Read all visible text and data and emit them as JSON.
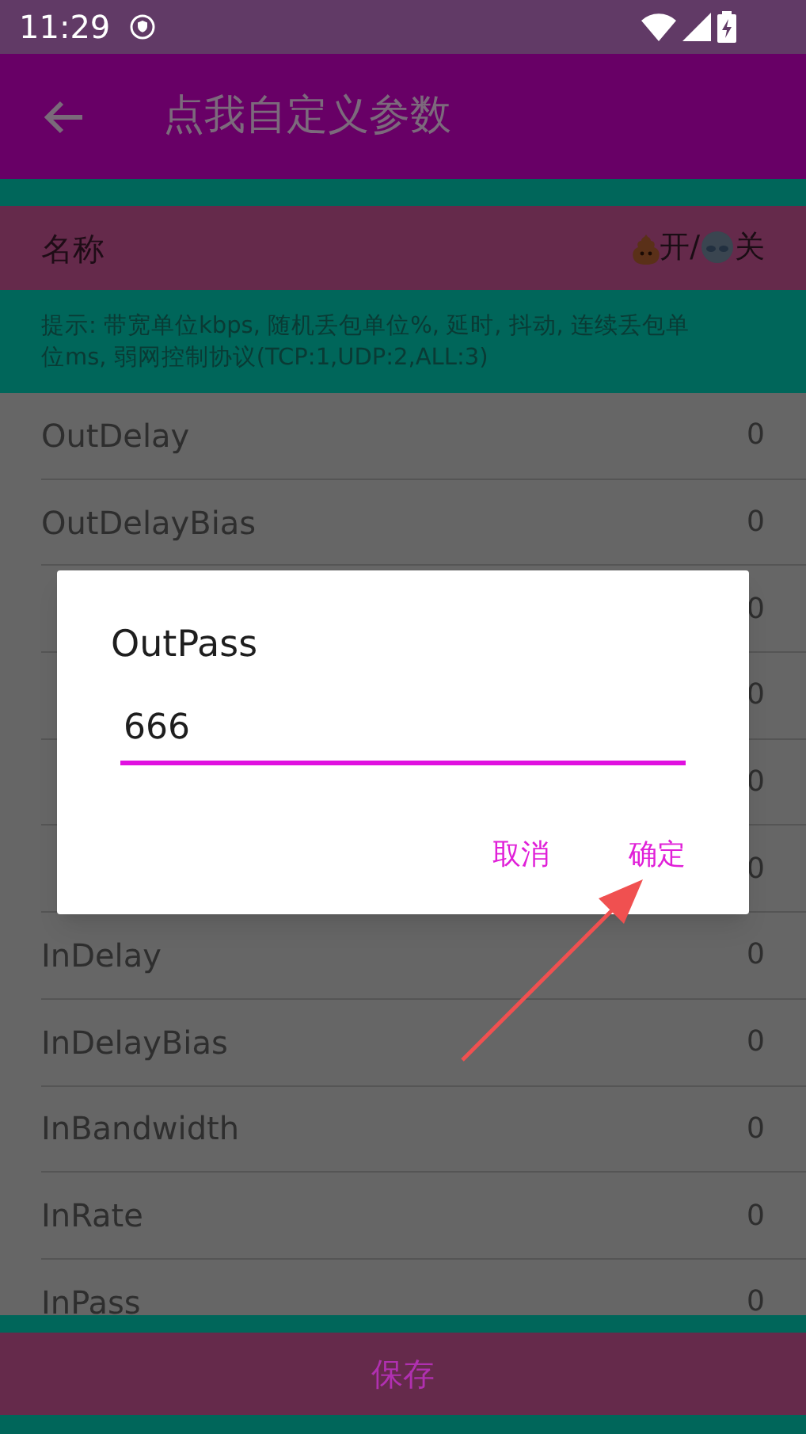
{
  "status_bar": {
    "time": "11:29"
  },
  "app_bar": {
    "title": "点我自定义参数"
  },
  "header": {
    "name_label": "名称",
    "on_label": "开/",
    "off_label": "关"
  },
  "hint": "提示: 带宽单位kbps, 随机丢包单位%, 延时, 抖动, 连续丢包单位ms, 弱网控制协议(TCP:1,UDP:2,ALL:3)",
  "rows": [
    {
      "name": "OutDelay",
      "value": "0"
    },
    {
      "name": "OutDelayBias",
      "value": "0"
    },
    {
      "value": "0"
    },
    {
      "value": "0"
    },
    {
      "value": "0"
    },
    {
      "value": "0"
    },
    {
      "name": "InDelay",
      "value": "0"
    },
    {
      "name": "InDelayBias",
      "value": "0"
    },
    {
      "name": "InBandwidth",
      "value": "0"
    },
    {
      "name": "InRate",
      "value": "0"
    },
    {
      "name": "InPass",
      "value": "0"
    }
  ],
  "save_button": "保存",
  "dialog": {
    "title": "OutPass",
    "value": "666",
    "buttons": [
      "取消",
      "确定"
    ]
  }
}
